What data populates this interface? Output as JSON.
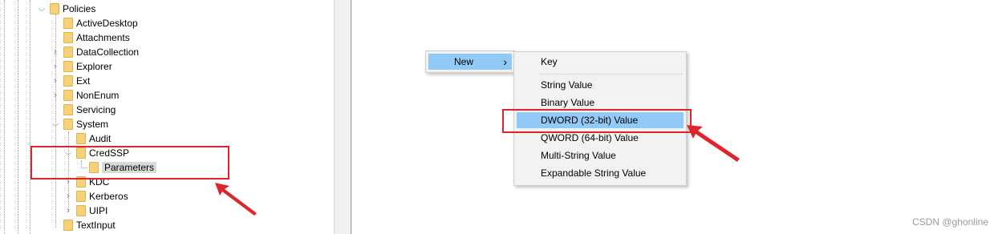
{
  "tree": {
    "items": [
      {
        "label": "Policies"
      },
      {
        "label": "ActiveDesktop"
      },
      {
        "label": "Attachments"
      },
      {
        "label": "DataCollection"
      },
      {
        "label": "Explorer"
      },
      {
        "label": "Ext"
      },
      {
        "label": "NonEnum"
      },
      {
        "label": "Servicing"
      },
      {
        "label": "System"
      },
      {
        "label": "Audit"
      },
      {
        "label": "CredSSP"
      },
      {
        "label": "Parameters"
      },
      {
        "label": "KDC"
      },
      {
        "label": "Kerberos"
      },
      {
        "label": "UIPI"
      },
      {
        "label": "TextInput"
      }
    ]
  },
  "context_menu": {
    "new_label": "New",
    "submenu_arrow": "›"
  },
  "submenu": {
    "items": [
      {
        "label": "Key"
      },
      {
        "label": "String Value"
      },
      {
        "label": "Binary Value"
      },
      {
        "label": "DWORD (32-bit) Value"
      },
      {
        "label": "QWORD (64-bit) Value"
      },
      {
        "label": "Multi-String Value"
      },
      {
        "label": "Expandable String Value"
      }
    ]
  },
  "watermark": "CSDN @ghonline",
  "colors": {
    "highlight": "#91c9f7",
    "annotation_red": "#e0242b",
    "folder": "#f6d07a"
  }
}
